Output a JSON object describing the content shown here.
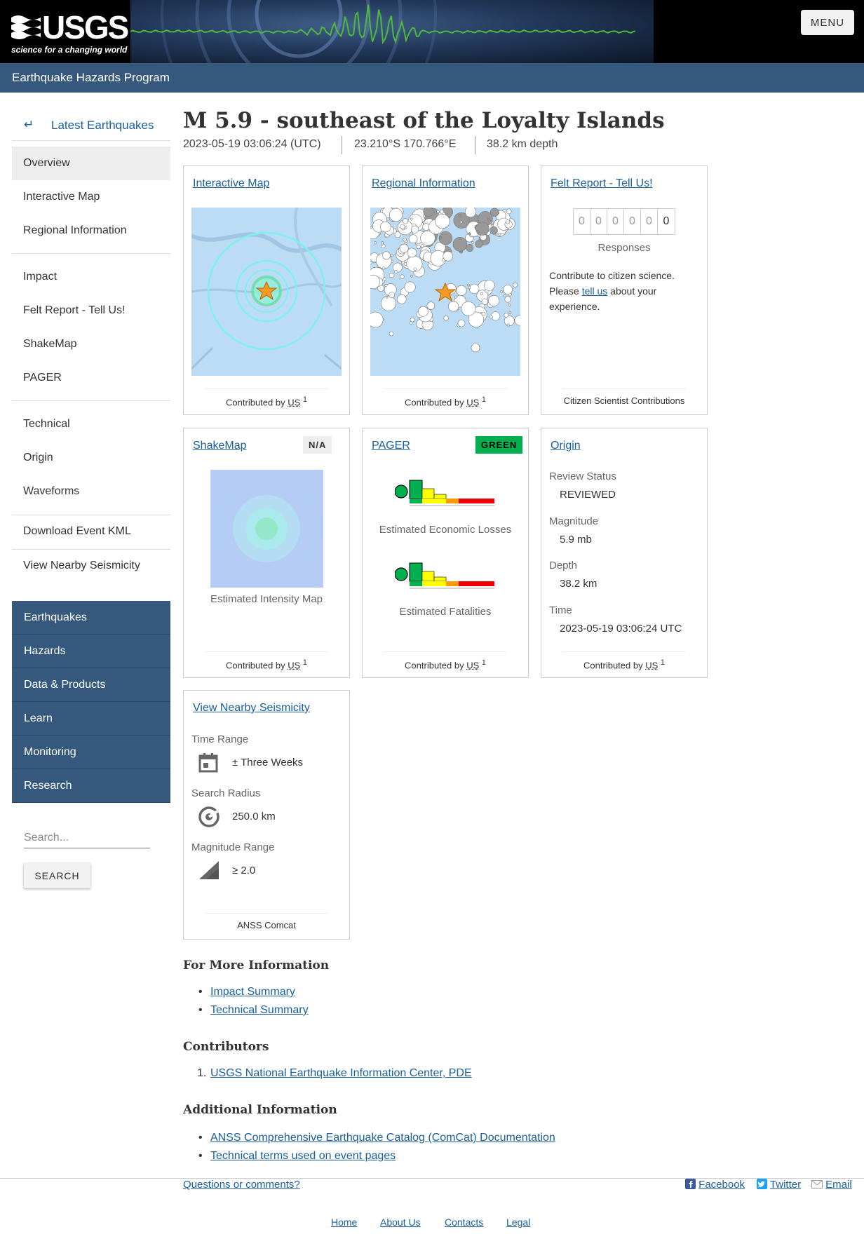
{
  "header": {
    "logo_text": "USGS",
    "logo_tagline": "science for a changing world",
    "menu_label": "MENU",
    "program_title": "Earthquake Hazards Program"
  },
  "sidebar": {
    "back_label": "Latest Earthquakes",
    "items": [
      {
        "label": "Overview",
        "active": true
      },
      {
        "label": "Interactive Map"
      },
      {
        "label": "Regional Information"
      },
      {
        "label": "Impact"
      },
      {
        "label": "Felt Report - Tell Us!"
      },
      {
        "label": "ShakeMap"
      },
      {
        "label": "PAGER"
      },
      {
        "label": "Technical"
      },
      {
        "label": "Origin"
      },
      {
        "label": "Waveforms"
      },
      {
        "label": "Download Event KML"
      },
      {
        "label": "View Nearby Seismicity"
      }
    ],
    "nav": [
      "Earthquakes",
      "Hazards",
      "Data & Products",
      "Learn",
      "Monitoring",
      "Research"
    ],
    "search_placeholder": "Search...",
    "search_button": "SEARCH"
  },
  "event": {
    "title": "M 5.9 - southeast of the Loyalty Islands",
    "time": "2023-05-19 03:06:24 (UTC)",
    "location": "23.210°S 170.766°E",
    "depth": "38.2 km depth"
  },
  "cards": {
    "interactive_map": {
      "title": "Interactive Map",
      "contrib_prefix": "Contributed by ",
      "contrib_net": "US",
      "contrib_sup": "1"
    },
    "regional": {
      "title": "Regional Information",
      "contrib_prefix": "Contributed by ",
      "contrib_net": "US",
      "contrib_sup": "1"
    },
    "felt": {
      "title": "Felt Report - Tell Us!",
      "digits": [
        "0",
        "0",
        "0",
        "0",
        "0",
        "0"
      ],
      "responses_label": "Responses",
      "text_line1": "Contribute to citizen science.",
      "text_please": "Please ",
      "text_link": "tell us",
      "text_after": " about your",
      "text_line3": "experience.",
      "footer": "Citizen Scientist Contributions"
    },
    "shakemap": {
      "title": "ShakeMap",
      "badge": "N/A",
      "caption": "Estimated Intensity Map",
      "contrib_prefix": "Contributed by ",
      "contrib_net": "US",
      "contrib_sup": "1"
    },
    "pager": {
      "title": "PAGER",
      "badge": "GREEN",
      "caption_econ": "Estimated Economic Losses",
      "caption_fatal": "Estimated Fatalities",
      "contrib_prefix": "Contributed by ",
      "contrib_net": "US",
      "contrib_sup": "1"
    },
    "origin": {
      "title": "Origin",
      "review_label": "Review Status",
      "review_value": "REVIEWED",
      "mag_label": "Magnitude",
      "mag_value": "5.9 mb",
      "depth_label": "Depth",
      "depth_value": "38.2 km",
      "time_label": "Time",
      "time_value": "2023-05-19 03:06:24 UTC",
      "contrib_prefix": "Contributed by ",
      "contrib_net": "US",
      "contrib_sup": "1"
    },
    "nearby": {
      "title": "View Nearby Seismicity",
      "time_label": "Time Range",
      "time_value": "± Three Weeks",
      "radius_label": "Search Radius",
      "radius_value": "250.0 km",
      "mag_label": "Magnitude Range",
      "mag_value": "≥ 2.0",
      "footer": "ANSS Comcat"
    }
  },
  "more_info": {
    "title": "For More Information",
    "links": [
      "Impact Summary",
      "Technical Summary"
    ]
  },
  "contributors": {
    "title": "Contributors",
    "items": [
      "USGS National Earthquake Information Center, PDE"
    ]
  },
  "additional": {
    "title": "Additional Information",
    "links": [
      "ANSS Comprehensive Earthquake Catalog (ComCat) Documentation",
      "Technical terms used on event pages"
    ]
  },
  "footer": {
    "questions": "Questions or comments?",
    "facebook": "Facebook",
    "twitter": "Twitter",
    "email": "Email",
    "links": [
      "Home",
      "About Us",
      "Contacts",
      "Legal"
    ]
  },
  "colors": {
    "brand": "#36587d",
    "link": "#1a5f9e",
    "pager_green": "#00b04f"
  }
}
